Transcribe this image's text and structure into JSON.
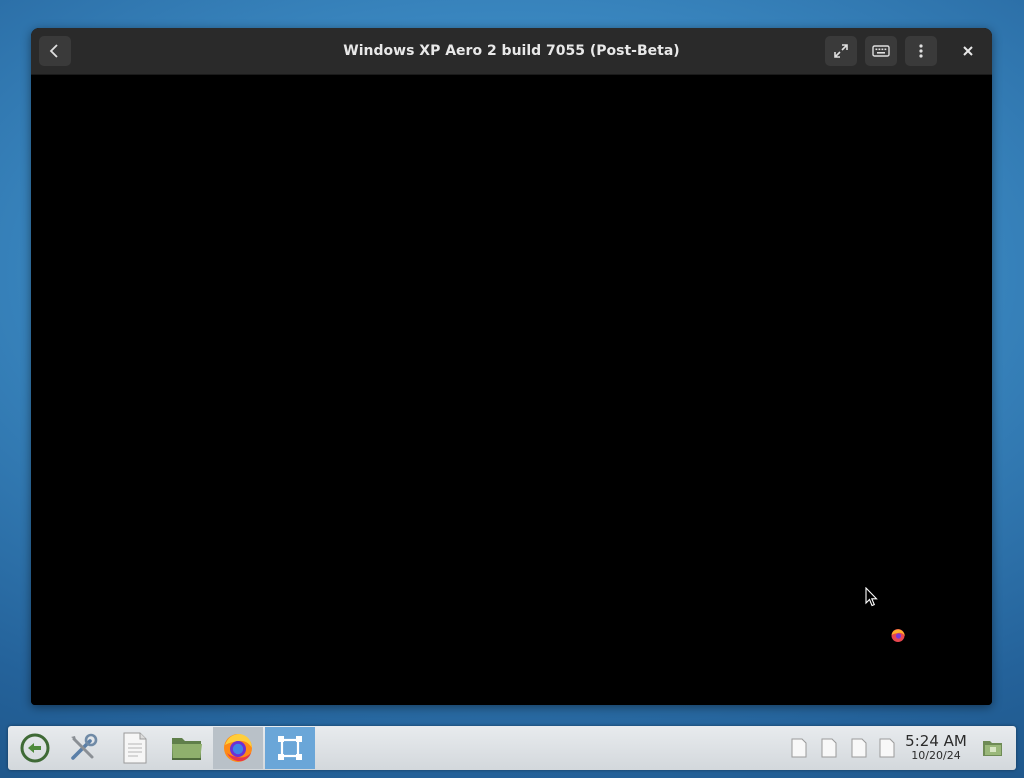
{
  "window": {
    "title": "Windows XP Aero 2 build 7055 (Post-Beta)",
    "buttons": [
      "back",
      "fullscreen",
      "keyboard",
      "menu",
      "close"
    ]
  },
  "taskbar": {
    "launchers": [
      {
        "name": "menu-icon"
      },
      {
        "name": "settings-tools-icon"
      },
      {
        "name": "text-editor-icon"
      },
      {
        "name": "file-manager-icon"
      },
      {
        "name": "firefox-icon",
        "active": true
      },
      {
        "name": "boxes-icon",
        "active": true
      }
    ],
    "clock": {
      "time": "5:24 AM",
      "date": "10/20/24"
    }
  },
  "colors": {
    "headerbar": "#2a2a2a",
    "taskbar": "#e1e5e8",
    "active_launcher": "#6aa6d8"
  }
}
